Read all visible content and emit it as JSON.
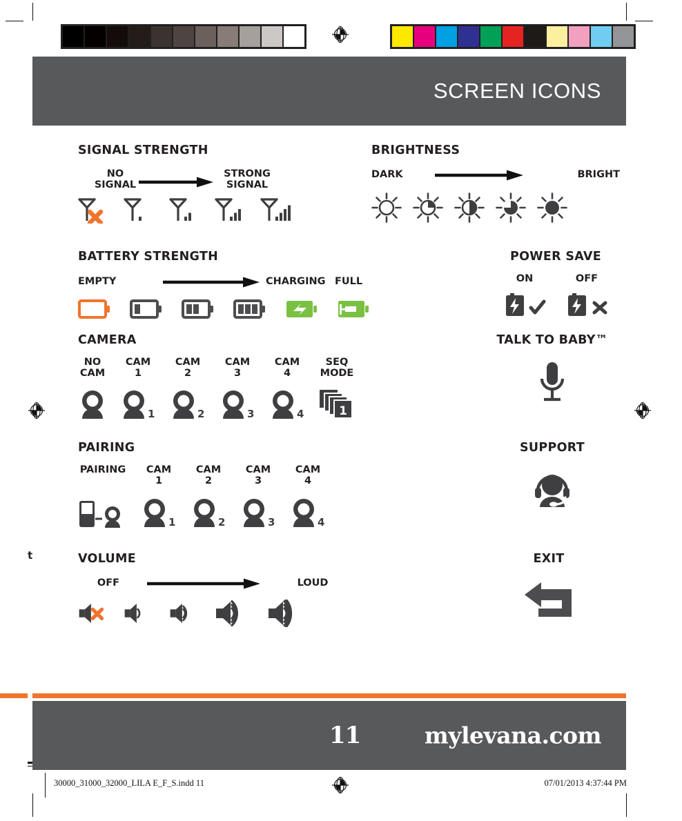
{
  "header": {
    "title": "SCREEN ICONS"
  },
  "footer": {
    "page_number": "11",
    "website": "mylevana.com"
  },
  "print_marks": {
    "slug_left": "30000_31000_32000_LILA E_F_S.indd   11",
    "slug_right": "07/01/2013   4:37:44 PM",
    "bleed_text": "t",
    "grayscale_swatches": [
      "#000000",
      "#040000",
      "#140c0a",
      "#241c19",
      "#3b332f",
      "#4e4542",
      "#6b605c",
      "#877c78",
      "#a6a09c",
      "#cbc8c5",
      "#ffffff"
    ],
    "color_swatches": [
      "#ffe800",
      "#e6007e",
      "#00a0e3",
      "#2e3192",
      "#00a057",
      "#e52421",
      "#1e1a18",
      "#fbf0a0",
      "#f2a0c0",
      "#6fcdf2",
      "#939598"
    ]
  },
  "sections": {
    "signal_strength": {
      "title": "SIGNAL STRENGTH",
      "start_label": "NO\nSIGNAL",
      "end_label": "STRONG\nSIGNAL",
      "icons": [
        {
          "name": "signal-no-signal",
          "bars": 0,
          "x_mark": true
        },
        {
          "name": "signal-1-bar",
          "bars": 1,
          "x_mark": false
        },
        {
          "name": "signal-2-bars",
          "bars": 2,
          "x_mark": false
        },
        {
          "name": "signal-3-bars",
          "bars": 3,
          "x_mark": false
        },
        {
          "name": "signal-4-bars",
          "bars": 4,
          "x_mark": false
        }
      ]
    },
    "brightness": {
      "title": "BRIGHTNESS",
      "start_label": "DARK",
      "end_label": "BRIGHT",
      "icons": [
        {
          "name": "brightness-level-1",
          "fill": 0
        },
        {
          "name": "brightness-level-2",
          "fill": 25
        },
        {
          "name": "brightness-level-3",
          "fill": 50
        },
        {
          "name": "brightness-level-4",
          "fill": 75
        },
        {
          "name": "brightness-level-5",
          "fill": 100
        }
      ]
    },
    "battery_strength": {
      "title": "BATTERY STRENGTH",
      "start_label": "EMPTY",
      "charging_label": "CHARGING",
      "full_label": "FULL",
      "icons": [
        {
          "name": "battery-empty",
          "bars": 0,
          "color": "#f1742e"
        },
        {
          "name": "battery-1-bar",
          "bars": 1,
          "color": "#4d4d4f"
        },
        {
          "name": "battery-2-bars",
          "bars": 2,
          "color": "#4d4d4f"
        },
        {
          "name": "battery-3-bars",
          "bars": 3,
          "color": "#4d4d4f"
        },
        {
          "name": "battery-charging",
          "bars": -1,
          "color": "#7ac143"
        },
        {
          "name": "battery-full-plug",
          "bars": -2,
          "color": "#7ac143"
        }
      ]
    },
    "camera": {
      "title": "CAMERA",
      "items": [
        {
          "label": "NO\nCAM",
          "name": "camera-no-cam",
          "num": ""
        },
        {
          "label": "CAM\n1",
          "name": "camera-cam-1",
          "num": "1"
        },
        {
          "label": "CAM\n2",
          "name": "camera-cam-2",
          "num": "2"
        },
        {
          "label": "CAM\n3",
          "name": "camera-cam-3",
          "num": "3"
        },
        {
          "label": "CAM\n4",
          "name": "camera-cam-4",
          "num": "4"
        },
        {
          "label": "SEQ\nMODE",
          "name": "camera-seq-mode",
          "num": "1"
        }
      ]
    },
    "pairing": {
      "title": "PAIRING",
      "items": [
        {
          "label": "PAIRING",
          "name": "pairing-link",
          "num": ""
        },
        {
          "label": "CAM\n1",
          "name": "pairing-cam-1",
          "num": "1"
        },
        {
          "label": "CAM\n2",
          "name": "pairing-cam-2",
          "num": "2"
        },
        {
          "label": "CAM\n3",
          "name": "pairing-cam-3",
          "num": "3"
        },
        {
          "label": "CAM\n4",
          "name": "pairing-cam-4",
          "num": "4"
        }
      ]
    },
    "volume": {
      "title": "VOLUME",
      "start_label": "OFF",
      "end_label": "LOUD",
      "icons": [
        {
          "name": "volume-off",
          "waves": 0,
          "x_mark": true
        },
        {
          "name": "volume-low",
          "waves": 1,
          "x_mark": false
        },
        {
          "name": "volume-medium",
          "waves": 2,
          "x_mark": false
        },
        {
          "name": "volume-high",
          "waves": 3,
          "x_mark": false
        },
        {
          "name": "volume-loud",
          "waves": 4,
          "x_mark": false
        }
      ]
    },
    "power_save": {
      "title": "POWER SAVE",
      "items": [
        {
          "label": "ON",
          "name": "power-save-on"
        },
        {
          "label": "OFF",
          "name": "power-save-off"
        }
      ]
    },
    "talk_to_baby": {
      "title": "TALK TO BABY™",
      "icon": "microphone-icon"
    },
    "support": {
      "title": "SUPPORT",
      "icon": "headset-support-icon"
    },
    "exit": {
      "title": "EXIT",
      "icon": "return-arrow-icon"
    }
  },
  "colors": {
    "header_gray": "#58595b",
    "accent_orange": "#f1742e",
    "icon_dark": "#3f3f41",
    "battery_green": "#7ac143"
  }
}
